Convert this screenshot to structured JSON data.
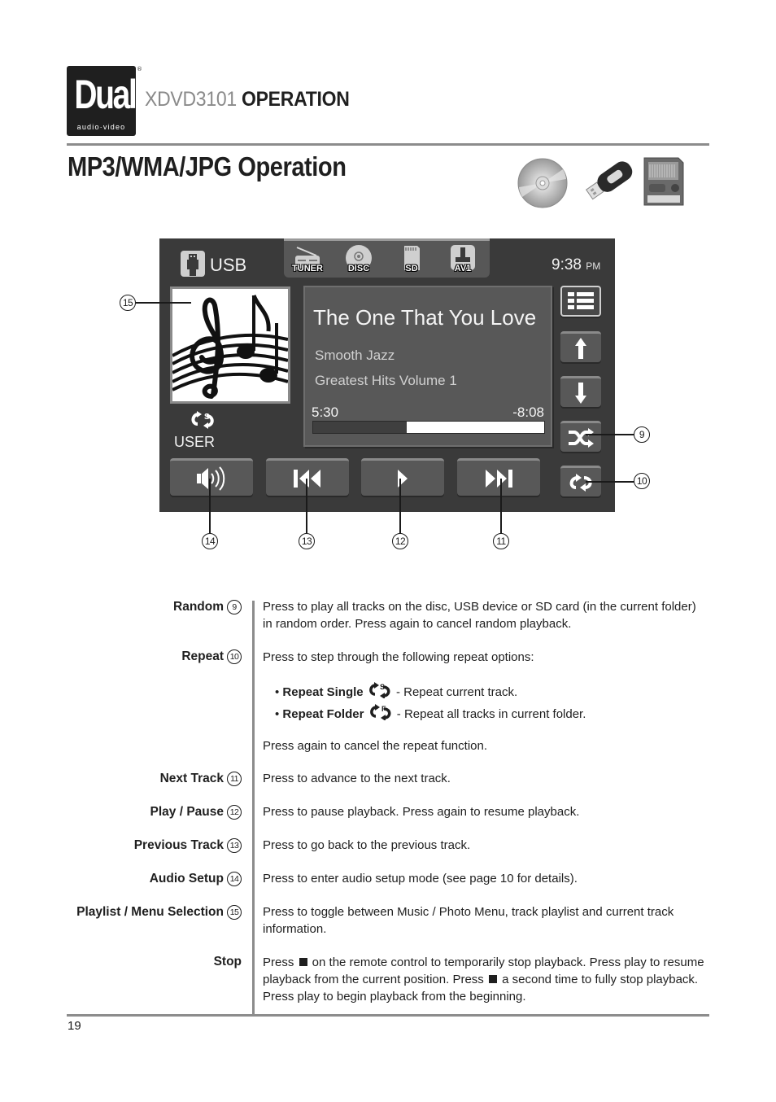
{
  "header": {
    "brand": "Dual",
    "brand_tagline": "audio·video",
    "registered_mark": "®",
    "model": "XDVD3101",
    "section": "OPERATION"
  },
  "page_title": "MP3/WMA/JPG Operation",
  "media_icons": [
    "cd-disc-icon",
    "usb-drive-icon",
    "sd-card-icon"
  ],
  "screen": {
    "source_label": "USB",
    "source_tabs": [
      {
        "label": "TUNER",
        "icon": "radio-icon"
      },
      {
        "label": "DISC",
        "icon": "disc-icon"
      },
      {
        "label": "SD",
        "icon": "sd-card-icon"
      },
      {
        "label": "AV1",
        "icon": "av-input-icon"
      }
    ],
    "clock": {
      "time": "9:38",
      "ampm": "PM"
    },
    "track": {
      "title": "The One That You Love",
      "artist": "Smooth Jazz",
      "album": "Greatest Hits Volume 1",
      "elapsed": "5:30",
      "remaining": "-8:08",
      "progress_fraction": 0.405
    },
    "eq_mode": "USER",
    "side_buttons": [
      "menu-list-icon",
      "arrow-up-icon",
      "arrow-down-icon",
      "shuffle-icon",
      "repeat-icon"
    ],
    "control_buttons": [
      "audio-setup-icon",
      "previous-track-icon",
      "play-icon",
      "next-track-icon"
    ]
  },
  "callouts": {
    "c9": "9",
    "c10": "10",
    "c11": "11",
    "c12": "12",
    "c13": "13",
    "c14": "14",
    "c15": "15"
  },
  "descriptions": [
    {
      "term": "Random",
      "num": "9",
      "text": "Press to play all tracks on the disc, USB device or SD card (in the current folder) in random order. Press again to cancel random playback."
    },
    {
      "term": "Repeat",
      "num": "10",
      "text": "Press to step through the following repeat options:",
      "bullets": [
        {
          "label": "Repeat Single",
          "text": " - Repeat current track."
        },
        {
          "label": "Repeat Folder",
          "text": " - Repeat all tracks in current folder."
        }
      ],
      "after": "Press again to cancel the repeat function."
    },
    {
      "term": "Next Track",
      "num": "11",
      "text": "Press to advance to the next track."
    },
    {
      "term": "Play / Pause",
      "num": "12",
      "text": "Press to pause playback. Press again to resume playback."
    },
    {
      "term": "Previous Track",
      "num": "13",
      "text": "Press to go back to the previous track."
    },
    {
      "term": "Audio Setup",
      "num": "14",
      "text": "Press to enter audio setup mode (see page 10 for details)."
    },
    {
      "term": "Playlist / Menu Selection",
      "num": "15",
      "text": "Press to toggle between Music / Photo Menu, track playlist and current track information."
    },
    {
      "term": "Stop",
      "text_parts": [
        "Press ",
        " on the remote control to temporarily stop playback. Press play to resume playback from the current position. Press ",
        " a second time to fully stop playback. Press play to begin playback from the beginning."
      ]
    }
  ],
  "page_number": "19"
}
